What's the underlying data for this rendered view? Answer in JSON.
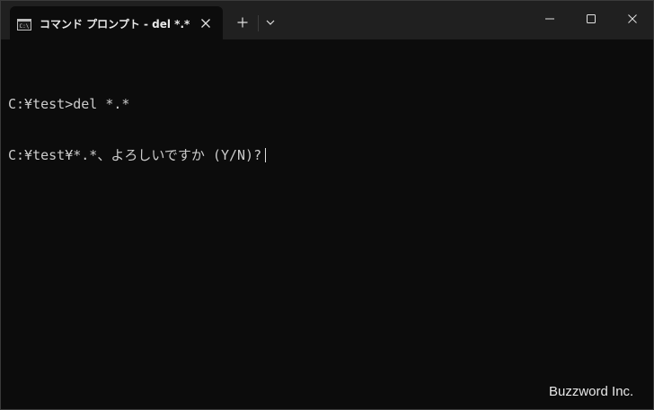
{
  "window": {
    "tab_title": "コマンド プロンプト - del  *.*",
    "tab_icon": "command-prompt-icon",
    "new_tab_icon": "plus-icon",
    "dropdown_icon": "chevron-down-icon",
    "controls": [
      "minimize-icon",
      "maximize-icon",
      "close-icon"
    ]
  },
  "terminal": {
    "lines": [
      "C:¥test>del *.*",
      "C:¥test¥*.*、よろしいですか (Y/N)?"
    ]
  },
  "watermark": "Buzzword Inc.",
  "colors": {
    "titlebar_bg": "#202020",
    "terminal_bg": "#0c0c0c",
    "terminal_fg": "#cccccc"
  }
}
